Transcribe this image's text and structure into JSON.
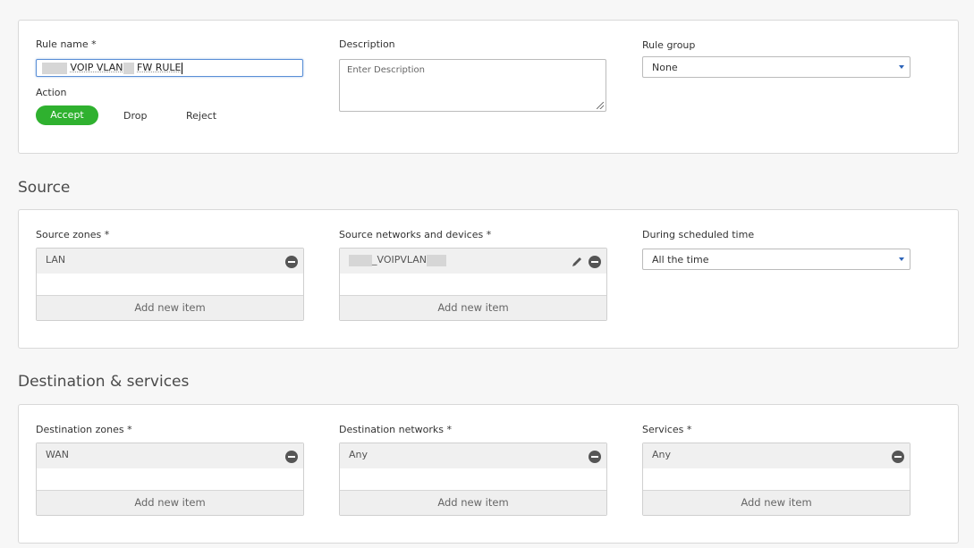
{
  "rule": {
    "name_label": "Rule name *",
    "name_value_visible": "VOIP VLAN FW RULE",
    "name_part1": "VOIP VLAN",
    "name_part2": "FW RULE",
    "description_label": "Description",
    "description_placeholder": "Enter Description",
    "group_label": "Rule group",
    "group_value": "None",
    "action_label": "Action",
    "actions": [
      "Accept",
      "Drop",
      "Reject"
    ],
    "selected_action": "Accept"
  },
  "source": {
    "section_title": "Source",
    "zones_label": "Source zones *",
    "zones": [
      "LAN"
    ],
    "networks_label": "Source networks and devices *",
    "networks_item": "_VOIPVLAN",
    "schedule_label": "During scheduled time",
    "schedule_value": "All the time",
    "add_new_item": "Add new item"
  },
  "destination": {
    "section_title": "Destination & services",
    "zones_label": "Destination zones *",
    "zones": [
      "WAN"
    ],
    "networks_label": "Destination networks *",
    "networks": [
      "Any"
    ],
    "services_label": "Services *",
    "services": [
      "Any"
    ],
    "add_new_item": "Add new item"
  },
  "colors": {
    "accent_green": "#2fb12f",
    "focus_blue": "#5a8fd6",
    "caret_blue": "#2c63b8"
  },
  "icons": {
    "remove": "remove-icon",
    "edit": "pencil-edit-icon",
    "dropdown": "chevron-down-icon",
    "resize": "resize-grip-icon"
  }
}
